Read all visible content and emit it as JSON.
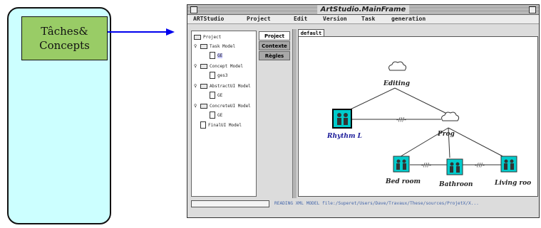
{
  "stage": {
    "label_line1": "Tâches&",
    "label_line2": "Concepts"
  },
  "window": {
    "title": "ArtStudio.MainFrame"
  },
  "menu": {
    "items": [
      "ARTStudio",
      "Project",
      "Edit",
      "Version",
      "Task",
      "generation"
    ]
  },
  "tree": {
    "items": [
      {
        "label": "Project"
      },
      {
        "label": "Task Model"
      },
      {
        "label": "GE"
      },
      {
        "label": "Concept Model"
      },
      {
        "label": "ges3"
      },
      {
        "label": "AbstractUI Model"
      },
      {
        "label": "GE"
      },
      {
        "label": "ConcreteUI Model"
      },
      {
        "label": "GE"
      },
      {
        "label": "FinalUI Model"
      }
    ]
  },
  "side_tabs": [
    "Project",
    "Contexte",
    "Règles"
  ],
  "canvas": {
    "tab_label": "default",
    "nodes": {
      "editing": "Editing",
      "rhythm": "Rhythm L",
      "prog": "Prog",
      "bedroom": "Bed room",
      "bathroom": "Bathroon",
      "living": "Living roo"
    },
    "link_marks": "-///-"
  },
  "status": {
    "text": "READING XML MODEL file:/Superet/Users/Dave/Travaux/These/sources/ProjetX/X..."
  },
  "colors": {
    "stage_bg": "#ccffff",
    "stage_label_bg": "#99cc66",
    "arrow": "#0000ee",
    "icon_bg": "#00cccc"
  }
}
